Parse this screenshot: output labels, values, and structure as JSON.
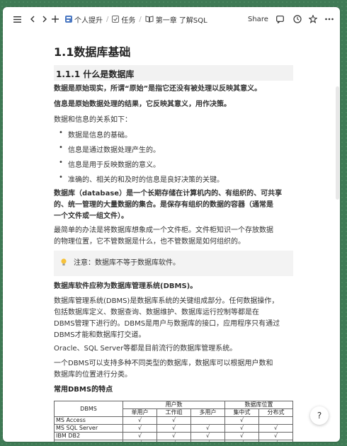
{
  "toolbar": {
    "breadcrumbs": [
      {
        "icon": "app-icon",
        "label": "个人提升"
      },
      {
        "icon": "checkbox-icon",
        "label": "任务"
      },
      {
        "icon": "book-icon",
        "label": "第一章 了解SQL"
      }
    ],
    "share_label": "Share"
  },
  "doc": {
    "title": "1.1数据库基础",
    "section_title": "1.1.1 什么是数据库",
    "line1": "数据是原始现实，所谓“原始”是指它还没有被处理以反映其意义。",
    "line2": "信息是原始数据处理的结果，它反映其意义，用作决策。",
    "line3": "数据和信息的关系如下：",
    "bullets": [
      "数据是信息的基础。",
      "信息是通过数据处理产生的。",
      "信息是用于反映数据的意义。",
      "准确的、相关的和及时的信息是良好决策的关键。"
    ],
    "db_def": [
      "数据库（database）是一个长期存储在计算机内的、有组织的、可共享",
      "的、统一管理的大量数据的集合。是保存有组织的数据的容器（通常是",
      "一个文件或一组文件）。"
    ],
    "cabinet": [
      "最简单的办法是将数据库想象成一个文件柜。文件柜知识一个存放数据",
      "的物理位置，它不管数据是什么，也不管数据是如何组织的。"
    ],
    "callout": "注意：数据库不等于数据库软件。",
    "dbms_heading": "数据库软件应称为数据库管理系统(DBMS)。",
    "dbms_desc": [
      "数据库管理系统(DBMS)是数据库系统的关键组成部分。任何数据操作，",
      "包括数据库定义、数据查询、数据维护、数据库运行控制等都是在",
      "DBMS管理下进行的。DBMS是用户与数据库的接口，应用程序只有通过",
      "DBMS才能和数据库打交道。"
    ],
    "oracle": "Oracle、SQL Server等都是目前流行的数据库管理系统。",
    "classify": [
      "一个DBMS可以支持多种不同类型的数据库，数据库可以根据用户数和",
      "数据库的位置进行分类。"
    ],
    "table_heading": "常用DBMS的特点",
    "table": {
      "col_dbms": "DBMS",
      "group_users": "用户数",
      "group_location": "数据库位置",
      "sub_headers": [
        "单用户",
        "工作组",
        "多用户",
        "集中式",
        "分布式"
      ],
      "rows": [
        {
          "name": "MS Access",
          "cells": [
            "√",
            "√",
            "",
            "√",
            ""
          ]
        },
        {
          "name": "MS SQL Server",
          "cells": [
            "√",
            "√",
            "√",
            "√",
            "√"
          ]
        },
        {
          "name": "IBM DB2",
          "cells": [
            "√",
            "√",
            "√",
            "√",
            "√"
          ]
        },
        {
          "name": "",
          "cells": [
            "√",
            "√",
            "√",
            "√",
            "√"
          ]
        }
      ]
    }
  },
  "help_label": "?"
}
